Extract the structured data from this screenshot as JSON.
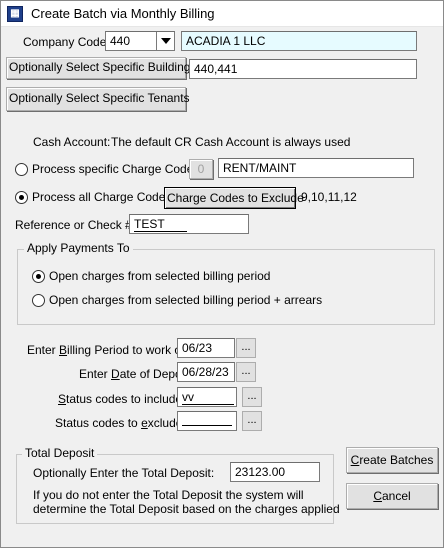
{
  "window": {
    "title": "Create Batch via Monthly Billing",
    "icon": "app-icon"
  },
  "company": {
    "label": "Company Code:",
    "code": "440",
    "name": "ACADIA 1 LLC"
  },
  "buildings": {
    "button_label": "Optionally Select Specific Buildings",
    "value": "440,441"
  },
  "tenants": {
    "button_label": "Optionally Select Specific Tenants"
  },
  "cash_account": {
    "label": "Cash Account:",
    "text": "The default CR Cash Account is always used"
  },
  "charge_code": {
    "specific_label": "Process specific Charge Code:",
    "specific_button": "0",
    "specific_value": "RENT/MAINT",
    "all_label": "Process all Charge Codes",
    "exclude_button": "Charge Codes to Exclude",
    "exclude_list": "9,10,11,12",
    "selected": "all"
  },
  "reference": {
    "label": "Reference or Check #",
    "value": "TEST"
  },
  "apply_payments": {
    "title": "Apply Payments To",
    "option1": "Open charges from selected billing period",
    "option2": "Open charges from selected billing period + arrears",
    "selected": "option1"
  },
  "dates": {
    "billing_label": "Enter Billing Period to work on:",
    "billing_value": "06/23",
    "deposit_label": "Enter Date of Deposit:",
    "deposit_value": "06/28/23",
    "include_label": "Status codes to include:",
    "include_value": "vv",
    "exclude_label": "Status codes to exclude:",
    "exclude_value": "",
    "picker_text": "..."
  },
  "total_deposit": {
    "title": "Total Deposit",
    "label": "Optionally Enter the Total Deposit:",
    "value": "23123.00",
    "note_line1": "If you do not enter the Total Deposit the system will",
    "note_line2": "determine the Total Deposit based on the charges applied"
  },
  "actions": {
    "create": "Create Batches",
    "cancel": "Cancel"
  }
}
